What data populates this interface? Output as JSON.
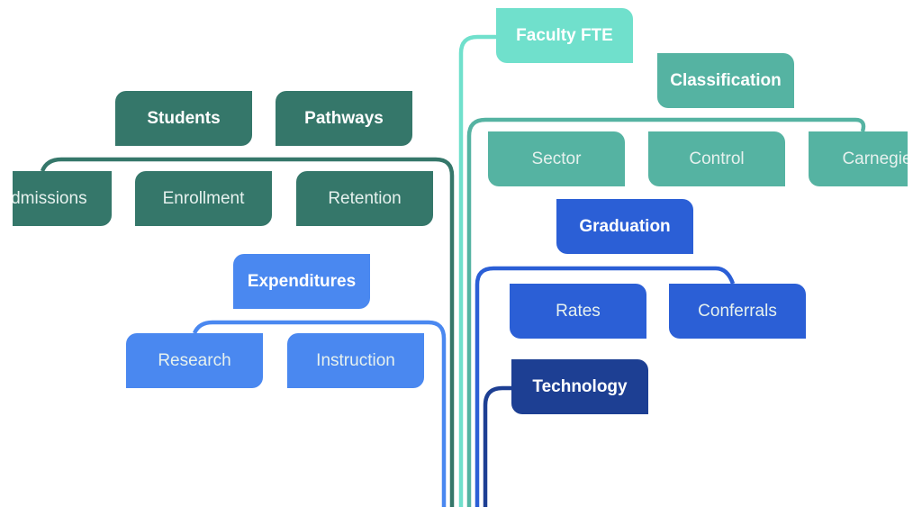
{
  "colors": {
    "students": "#35776a",
    "faculty": "#70e0cc",
    "classification": "#55b3a2",
    "graduation": "#2b5fd6",
    "expenditures": "#4a88f0",
    "technology": "#1d3f93"
  },
  "nodes": {
    "students": {
      "label": "Students",
      "children": [
        "Admissions",
        "Enrollment",
        "Retention"
      ]
    },
    "pathways": {
      "label": "Pathways"
    },
    "expenditures": {
      "label": "Expenditures",
      "children": [
        "Research",
        "Instruction"
      ]
    },
    "faculty": {
      "label": "Faculty FTE"
    },
    "classification": {
      "label": "Classification",
      "children": [
        "Sector",
        "Control",
        "Carnegie"
      ]
    },
    "graduation": {
      "label": "Graduation",
      "children": [
        "Rates",
        "Conferrals"
      ]
    },
    "technology": {
      "label": "Technology"
    }
  }
}
